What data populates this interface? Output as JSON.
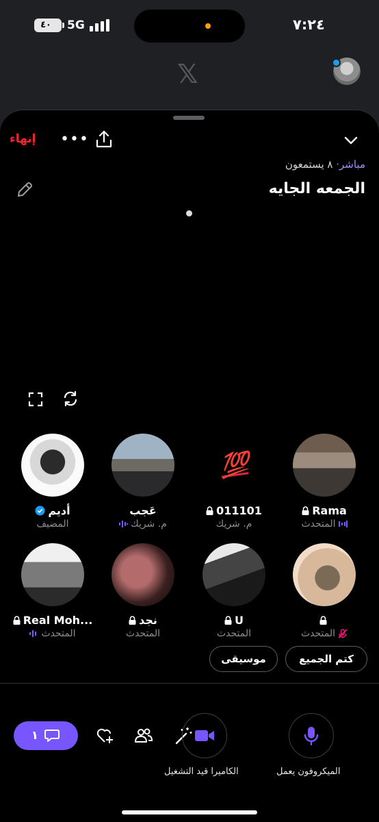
{
  "status_bar": {
    "time": "٧:٢٤",
    "network": "5G",
    "battery": "٤٠"
  },
  "background_app": {
    "logo": "𝕏"
  },
  "header": {
    "end_label": "إنهاء",
    "more_label": "•••"
  },
  "space": {
    "live_label": "مباشر·",
    "listeners": "٨ يستمعون",
    "title": "الجمعه الجايه"
  },
  "participants": [
    {
      "name": "أديم",
      "role": "المضيف",
      "verified": true,
      "avatar": "photo"
    },
    {
      "name": "عَجب",
      "role": "م. شريك",
      "avatar": "photo"
    },
    {
      "name": "011101",
      "role": "م. شريك",
      "locked": true,
      "avatar": "emoji",
      "emoji": "💯"
    },
    {
      "name": "Rama",
      "role": "المتحدث",
      "locked": true,
      "avatar": "photo"
    },
    {
      "name": "Real Moh...",
      "role": "المتحدث",
      "locked": true,
      "avatar": "photo"
    },
    {
      "name": "نجد",
      "role": "المتحدث",
      "locked": true,
      "avatar": "photo"
    },
    {
      "name": "U",
      "role": "المتحدث",
      "locked": true,
      "avatar": "photo"
    },
    {
      "name": "",
      "role": "المتحدث",
      "locked": true,
      "avatar": "photo",
      "muted": true
    }
  ],
  "actions": {
    "mute_all": "كتم الجميع",
    "music": "موسيقى"
  },
  "toolbar": {
    "chat_count": "١",
    "camera_label": "الكاميرا قيد التشغيل",
    "mic_label": "الميكروفون يعمل"
  },
  "colors": {
    "accent": "#7856ff",
    "end": "#f4212e",
    "live": "#a78bfa"
  }
}
